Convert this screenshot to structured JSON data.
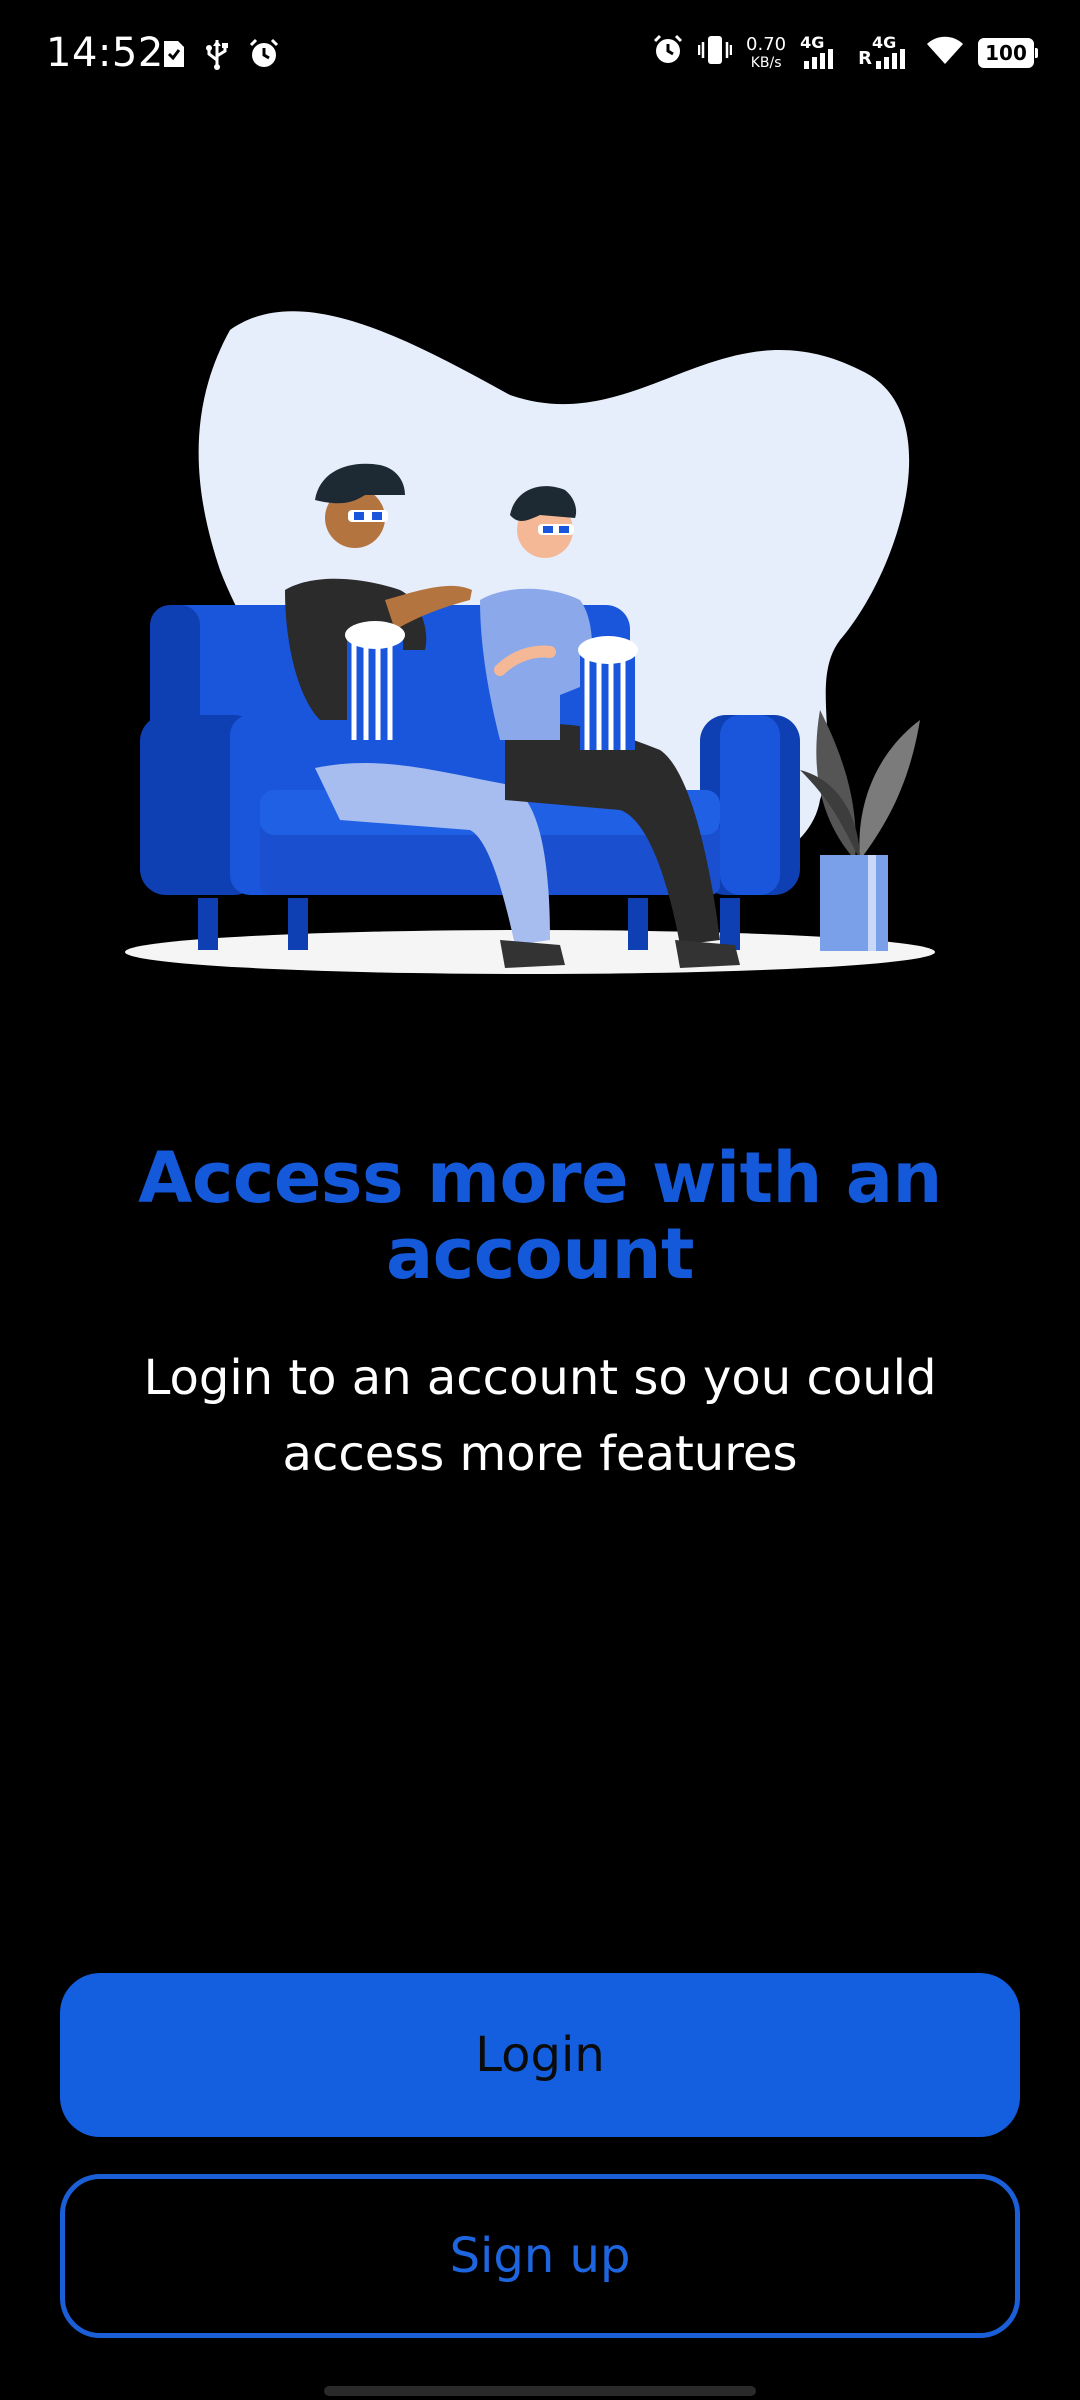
{
  "status_bar": {
    "time": "14:52",
    "net_speed_value": "0.70",
    "net_speed_unit": "KB/s",
    "sim1_label": "4G",
    "sim2_roaming": "R",
    "sim2_label": "4G",
    "battery": "100",
    "icons": [
      "sim-card-icon",
      "usb-icon",
      "alarm-icon",
      "alarm-icon",
      "vibrate-icon",
      "signal-icon",
      "wifi-icon",
      "battery-icon"
    ]
  },
  "illustration": {
    "name": "couple-watching-movie-on-couch",
    "colors": {
      "blob": "#e6edfb",
      "couch": "#1a56db",
      "couch_dark": "#0e3fb3",
      "floor": "#f5f5f5"
    }
  },
  "content": {
    "headline": "Access more with an account",
    "subtext": "Login to an account so you could access more features"
  },
  "actions": {
    "login_label": "Login",
    "signup_label": "Sign up"
  },
  "colors": {
    "accent": "#135fdf",
    "background": "#000000",
    "text": "#ffffff"
  }
}
